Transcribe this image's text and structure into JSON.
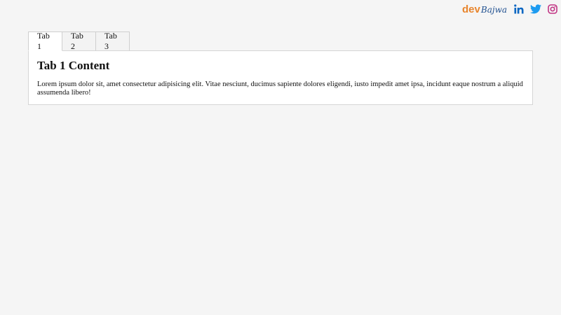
{
  "branding": {
    "logo_part1": "dev",
    "logo_part2": "Bajwa",
    "accent_orange": "#e8852d",
    "accent_blue": "#1f4f8f"
  },
  "social": [
    {
      "name": "linkedin",
      "icon": "linkedin-icon",
      "color": "#0a66c2"
    },
    {
      "name": "twitter",
      "icon": "twitter-icon",
      "color": "#1d9bf0"
    },
    {
      "name": "instagram",
      "icon": "instagram-icon",
      "color": "#c13584"
    }
  ],
  "tabs": [
    {
      "label": "Tab 1",
      "active": true
    },
    {
      "label": "Tab 2",
      "active": false
    },
    {
      "label": "Tab 3",
      "active": false
    }
  ],
  "content": {
    "heading": "Tab 1 Content",
    "body": "Lorem ipsum dolor sit, amet consectetur adipisicing elit. Vitae nesciunt, ducimus sapiente dolores eligendi, iusto impedit amet ipsa, incidunt eaque nostrum a aliquid assumenda libero!"
  },
  "colors": {
    "page_background": "#f5f5f5",
    "panel_background": "#ffffff",
    "border": "#cfcfcf"
  }
}
